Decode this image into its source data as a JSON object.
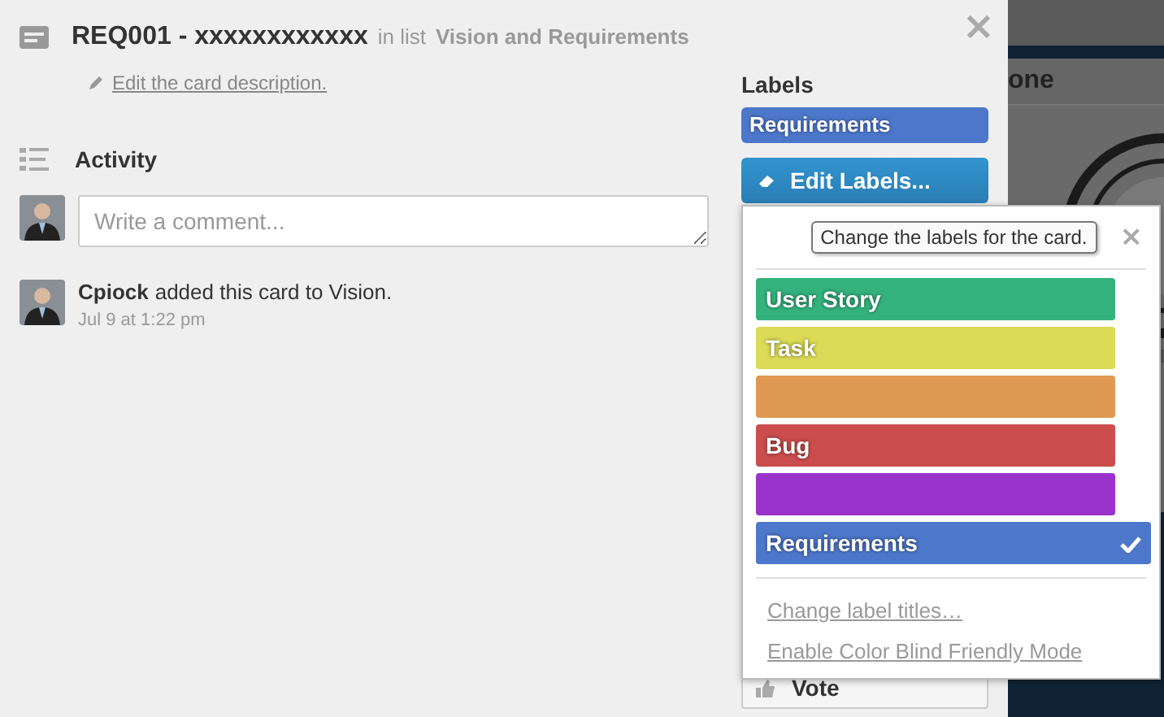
{
  "card": {
    "title": "REQ001 - xxxxxxxxxxxx",
    "list_prefix": "in list",
    "list_name": "Vision and Requirements",
    "edit_description": "Edit the card description.",
    "close": "×"
  },
  "activity": {
    "heading": "Activity",
    "comment_placeholder": "Write a comment...",
    "entries": [
      {
        "user": "Cpiock",
        "action": "added this card to Vision.",
        "time": "Jul 9 at 1:22 pm"
      }
    ]
  },
  "sidebar": {
    "heading": "Labels",
    "labels": [
      {
        "name": "Requirements",
        "color": "#4d77cb"
      }
    ],
    "edit_button": "Edit Labels...",
    "vote_button": "Vote"
  },
  "popover": {
    "tooltip": "Change the labels for the card.",
    "close": "×",
    "labels": [
      {
        "name": "User Story",
        "color": "#34b27d",
        "selected": false
      },
      {
        "name": "Task",
        "color": "#dbdb57",
        "selected": false
      },
      {
        "color": "#e09952",
        "selected": false
      },
      {
        "name": "Bug",
        "color": "#cb4d4d",
        "selected": false
      },
      {
        "color": "#9933cc",
        "selected": false
      },
      {
        "name": "Requirements",
        "color": "#4d77cb",
        "selected": true
      }
    ],
    "links": [
      "Change label titles…",
      "Enable Color Blind Friendly Mode"
    ]
  },
  "background": {
    "column_title": "one"
  }
}
